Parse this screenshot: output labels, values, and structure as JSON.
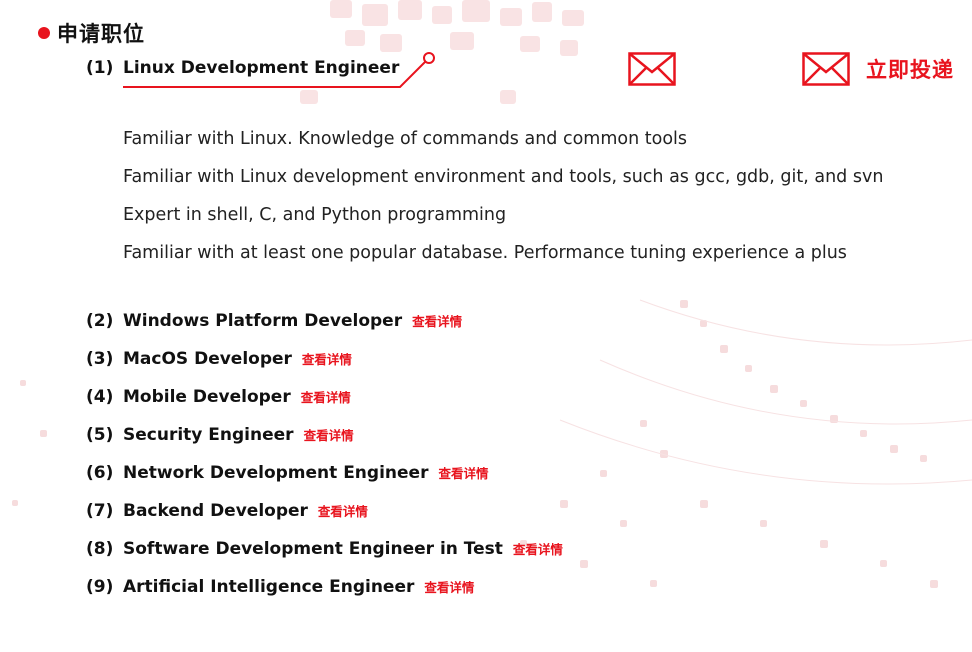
{
  "section": {
    "title": "申请职位"
  },
  "active_job": {
    "number": "(1)",
    "title": "Linux Development Engineer"
  },
  "apply": {
    "label": "立即投递"
  },
  "requirements": [
    "Familiar with Linux. Knowledge of commands and common tools",
    "Familiar with Linux development environment and tools, such as gcc, gdb, git, and svn",
    "Expert in shell, C, and Python programming",
    "Familiar with at least one popular database. Performance tuning experience a plus"
  ],
  "jobs": [
    {
      "number": "(2)",
      "title": "Windows Platform Developer",
      "link": "查看详情"
    },
    {
      "number": "(3)",
      "title": "MacOS Developer",
      "link": "查看详情"
    },
    {
      "number": "(4)",
      "title": "Mobile Developer",
      "link": "查看详情"
    },
    {
      "number": "(5)",
      "title": "Security Engineer",
      "link": "查看详情"
    },
    {
      "number": "(6)",
      "title": "Network Development Engineer",
      "link": "查看详情"
    },
    {
      "number": "(7)",
      "title": "Backend Developer",
      "link": "查看详情"
    },
    {
      "number": "(8)",
      "title": "Software Development Engineer in Test",
      "link": "查看详情"
    },
    {
      "number": "(9)",
      "title": "Artificial Intelligence Engineer",
      "link": "查看详情"
    }
  ],
  "icons": {
    "mail": "mail-icon",
    "bullet": "red-dot"
  },
  "colors": {
    "accent": "#e8141e",
    "text": "#111111",
    "background": "#ffffff"
  }
}
